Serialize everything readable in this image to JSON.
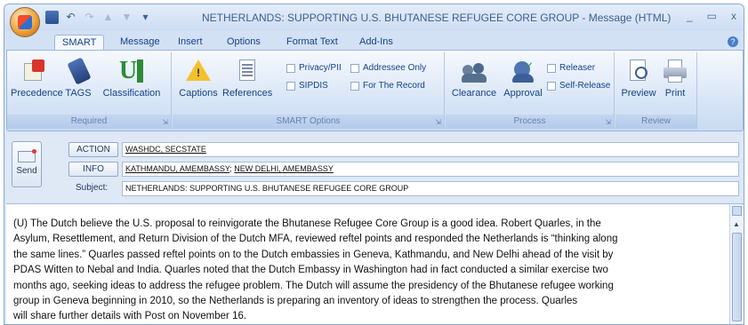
{
  "window": {
    "title": "NETHERLANDS: SUPPORTING U.S. BHUTANESE REFUGEE CORE GROUP - Message (HTML)",
    "controls": [
      "_",
      "▭",
      "x"
    ]
  },
  "quick_access": [
    "save-icon",
    "undo-icon",
    "redo-icon",
    "up-icon",
    "down-icon",
    "customize-icon"
  ],
  "tabs": [
    "SMART",
    "Message",
    "Insert",
    "Options",
    "Format Text",
    "Add-Ins"
  ],
  "ribbon": {
    "groups": {
      "required": {
        "label": "Required",
        "buttons": [
          "Precedence",
          "TAGS",
          "Classification"
        ]
      },
      "smart_options": {
        "label": "SMART Options",
        "buttons": [
          "Captions",
          "References"
        ],
        "checkboxes": [
          "Privacy/PII",
          "SIPDIS",
          "Addressee Only",
          "For The Record"
        ]
      },
      "process": {
        "label": "Process",
        "buttons": [
          "Clearance",
          "Approval"
        ],
        "checkboxes": [
          "Releaser",
          "Self-Release"
        ]
      },
      "review": {
        "label": "Review",
        "buttons": [
          "Preview",
          "Print"
        ]
      }
    }
  },
  "header": {
    "send_label": "Send",
    "action_label": "ACTION",
    "action_value": "WASHDC, SECSTATE",
    "info_label": "INFO",
    "info_value_1": "KATHMANDU, AMEMBASSY",
    "info_sep": "; ",
    "info_value_2": "NEW DELHI, AMEMBASSY",
    "subject_label": "Subject:",
    "subject_value": "NETHERLANDS: SUPPORTING U.S. BHUTANESE REFUGEE CORE GROUP"
  },
  "body": {
    "lines": [
      "(U) The Dutch believe the U.S. proposal to reinvigorate the Bhutanese Refugee Core Group is a good idea. Robert Quarles, in the",
      "Asylum, Resettlement, and Return Division of the Dutch MFA, reviewed reftel points and responded the Netherlands is “thinking along",
      "the same lines.” Quarles passed reftel points on to the Dutch embassies in Geneva, Kathmandu, and New Delhi ahead of the visit by",
      "PDAS Witten to Nebal and India. Quarles noted that the Dutch Embassy in Washington had in fact conducted a similar exercise two",
      "months ago, seeking ideas to address the refugee problem. The Dutch will assume the presidency of the Bhutanese refugee working",
      "group in Geneva beginning in 2010, so the Netherlands is preparing an inventory of ideas to strengthen the process. Quarles",
      "will share further details with Post on November 16."
    ]
  }
}
